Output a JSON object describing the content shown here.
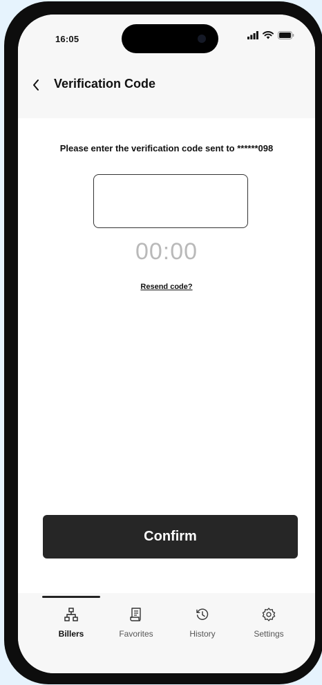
{
  "status_bar": {
    "time": "16:05"
  },
  "header": {
    "title": "Verification Code",
    "back_icon": "chevron-left-icon"
  },
  "verification": {
    "instruction": "Please enter the verification code sent to ******098",
    "code_value": "",
    "timer": "00:00",
    "resend_label": "Resend code?"
  },
  "actions": {
    "confirm_label": "Confirm"
  },
  "tabs": [
    {
      "label": "Billers",
      "icon": "sitemap-icon",
      "active": true
    },
    {
      "label": "Favorites",
      "icon": "receipt-icon",
      "active": false
    },
    {
      "label": "History",
      "icon": "history-icon",
      "active": false
    },
    {
      "label": "Settings",
      "icon": "gear-icon",
      "active": false
    }
  ],
  "colors": {
    "background": "#e6f3fd",
    "frame": "#0d0d0d",
    "button": "#262626",
    "timer": "#b9b9b9",
    "surface": "#f7f7f7"
  }
}
